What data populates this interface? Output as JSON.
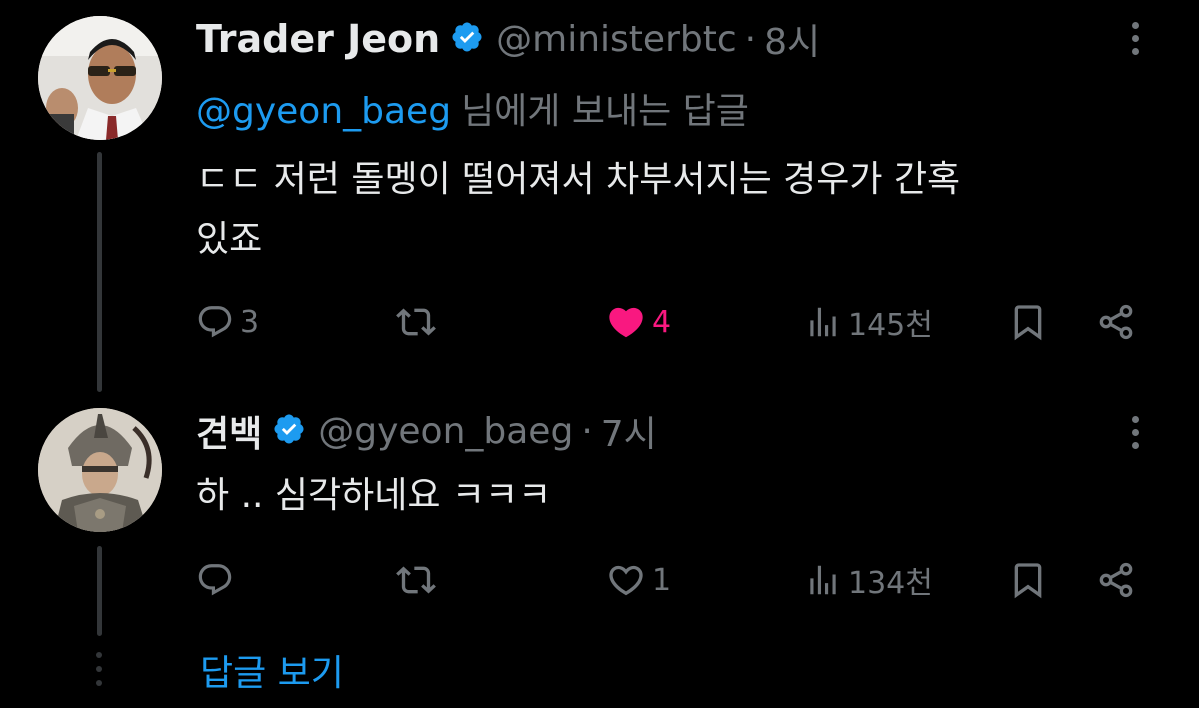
{
  "tweets": [
    {
      "name": "Trader Jeon",
      "handle": "@ministerbtc",
      "dot": "·",
      "time": "8시",
      "reply_mention": "@gyeon_baeg",
      "reply_suffix": "님에게 보내는 답글",
      "text_line1": "ㄷㄷ 저런 돌멩이 떨어져서 차부서지는 경우가 간혹",
      "text_line2": "있죠",
      "replies": "3",
      "retweets": "",
      "likes": "4",
      "liked": true,
      "views": "145천"
    },
    {
      "name": "견백",
      "handle": "@gyeon_baeg",
      "dot": "·",
      "time": "7시",
      "text_line1": "하 .. 심각하네요 ㅋㅋㅋ",
      "replies": "",
      "retweets": "",
      "likes": "1",
      "liked": false,
      "views": "134천"
    }
  ],
  "show_replies_label": "답글 보기",
  "colors": {
    "background": "#000000",
    "text": "#e7e9ea",
    "secondary": "#71767b",
    "accent": "#1d9bf0",
    "like": "#f91880"
  }
}
